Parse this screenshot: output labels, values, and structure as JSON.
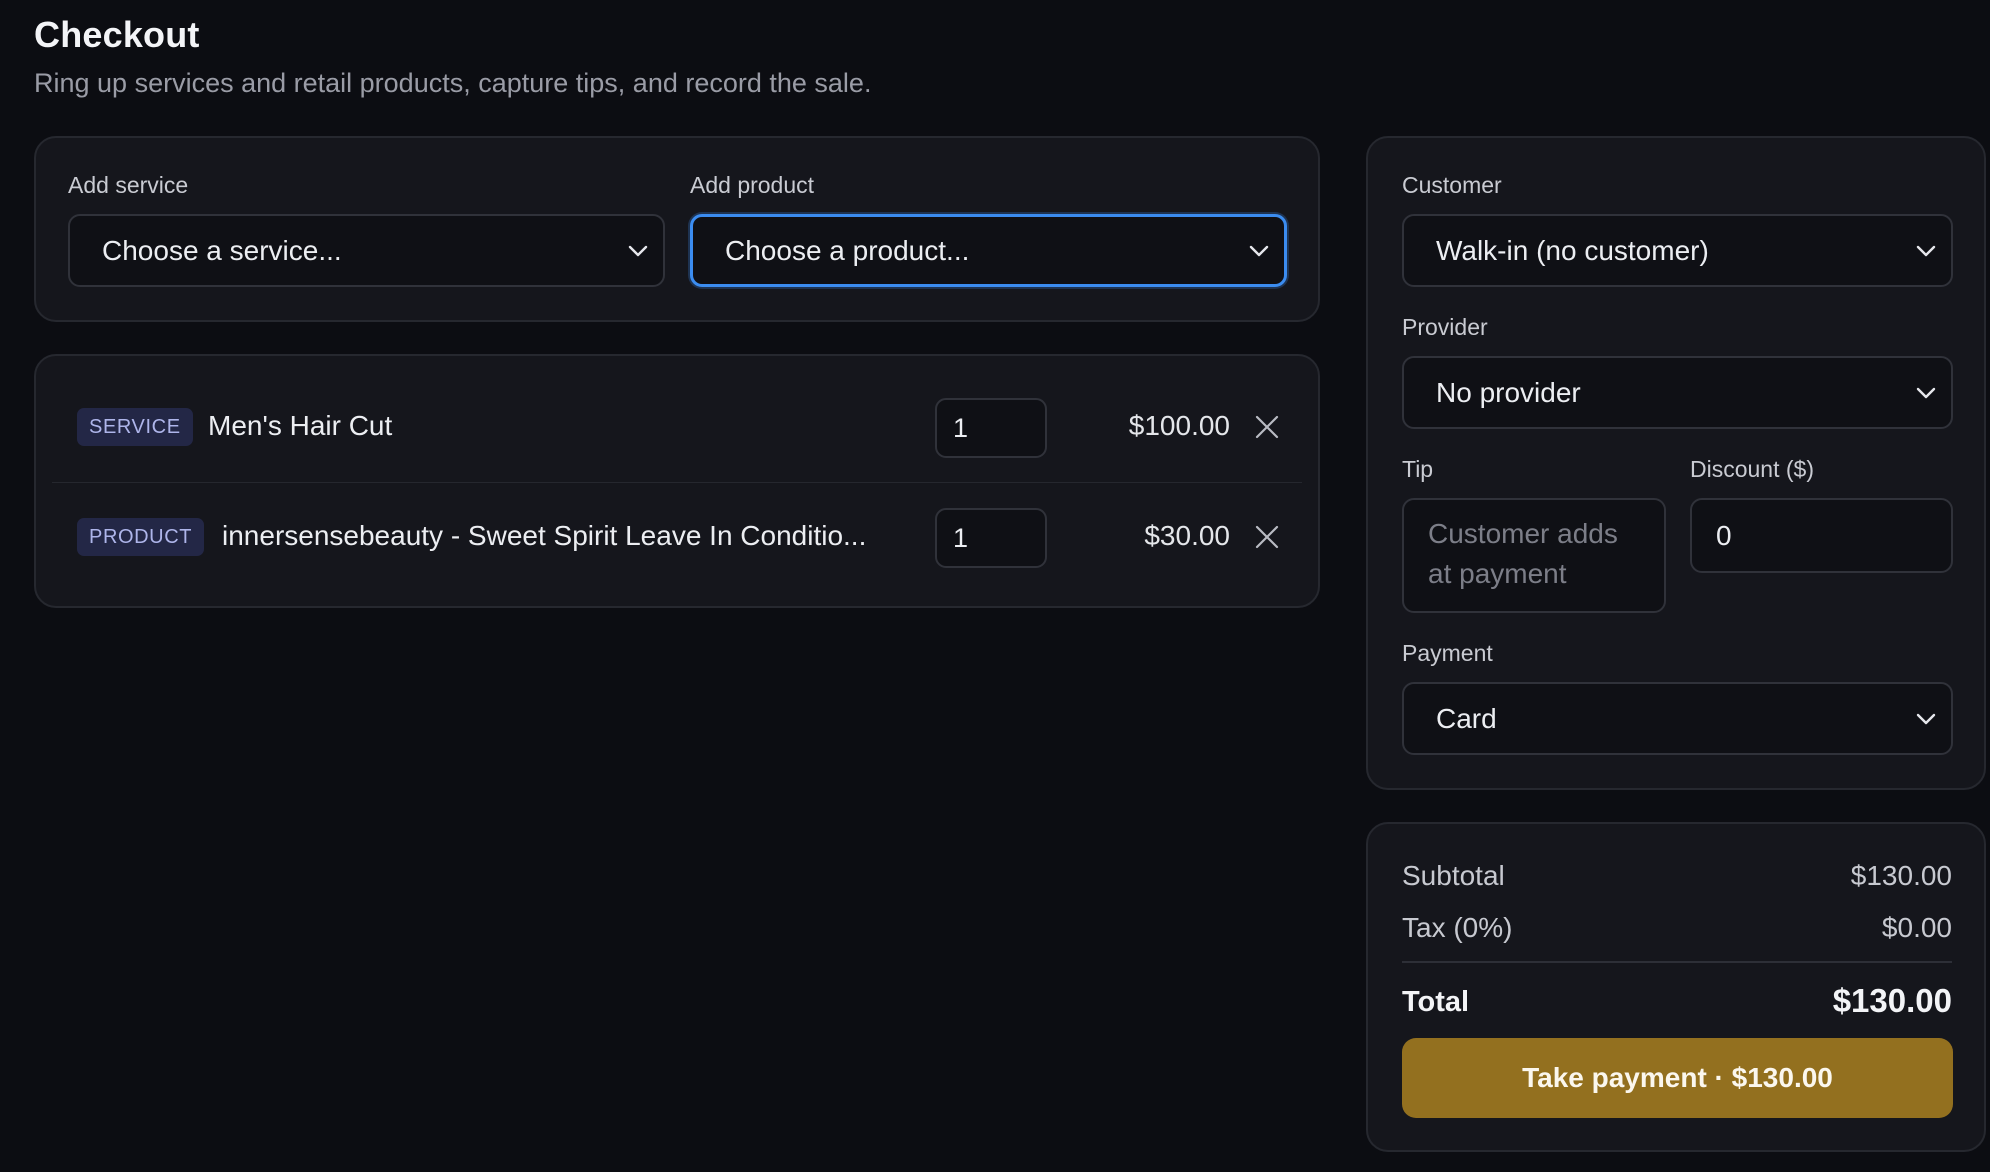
{
  "header": {
    "title": "Checkout",
    "subtitle": "Ring up services and retail products, capture tips, and record the sale."
  },
  "add_items": {
    "service": {
      "label": "Add service",
      "value": "Choose a service..."
    },
    "product": {
      "label": "Add product",
      "value": "Choose a product..."
    }
  },
  "cart": {
    "items": [
      {
        "type": "SERVICE",
        "name": "Men's Hair Cut",
        "qty": "1",
        "price": "$100.00"
      },
      {
        "type": "PRODUCT",
        "name": "innersensebeauty - Sweet Spirit Leave In Conditio...",
        "qty": "1",
        "price": "$30.00"
      }
    ]
  },
  "details": {
    "customer": {
      "label": "Customer",
      "value": "Walk-in (no customer)"
    },
    "provider": {
      "label": "Provider",
      "value": "No provider"
    },
    "tip": {
      "label": "Tip",
      "placeholder": "Customer adds at payment"
    },
    "discount": {
      "label": "Discount ($)",
      "value": "0"
    },
    "payment": {
      "label": "Payment",
      "value": "Card"
    }
  },
  "summary": {
    "subtotal_label": "Subtotal",
    "subtotal_value": "$130.00",
    "tax_label": "Tax (0%)",
    "tax_value": "$0.00",
    "total_label": "Total",
    "total_value": "$130.00",
    "pay_button": "Take payment · $130.00"
  },
  "colors": {
    "background": "#0c0d12",
    "card": "#15161c",
    "focus_ring": "#3b8cf0",
    "badge_bg": "#232746",
    "badge_text": "#aeb5ea",
    "pay_button": "#93701f"
  },
  "icons": {
    "select_arrow": "chevron-down-icon",
    "remove_item": "close-icon"
  }
}
